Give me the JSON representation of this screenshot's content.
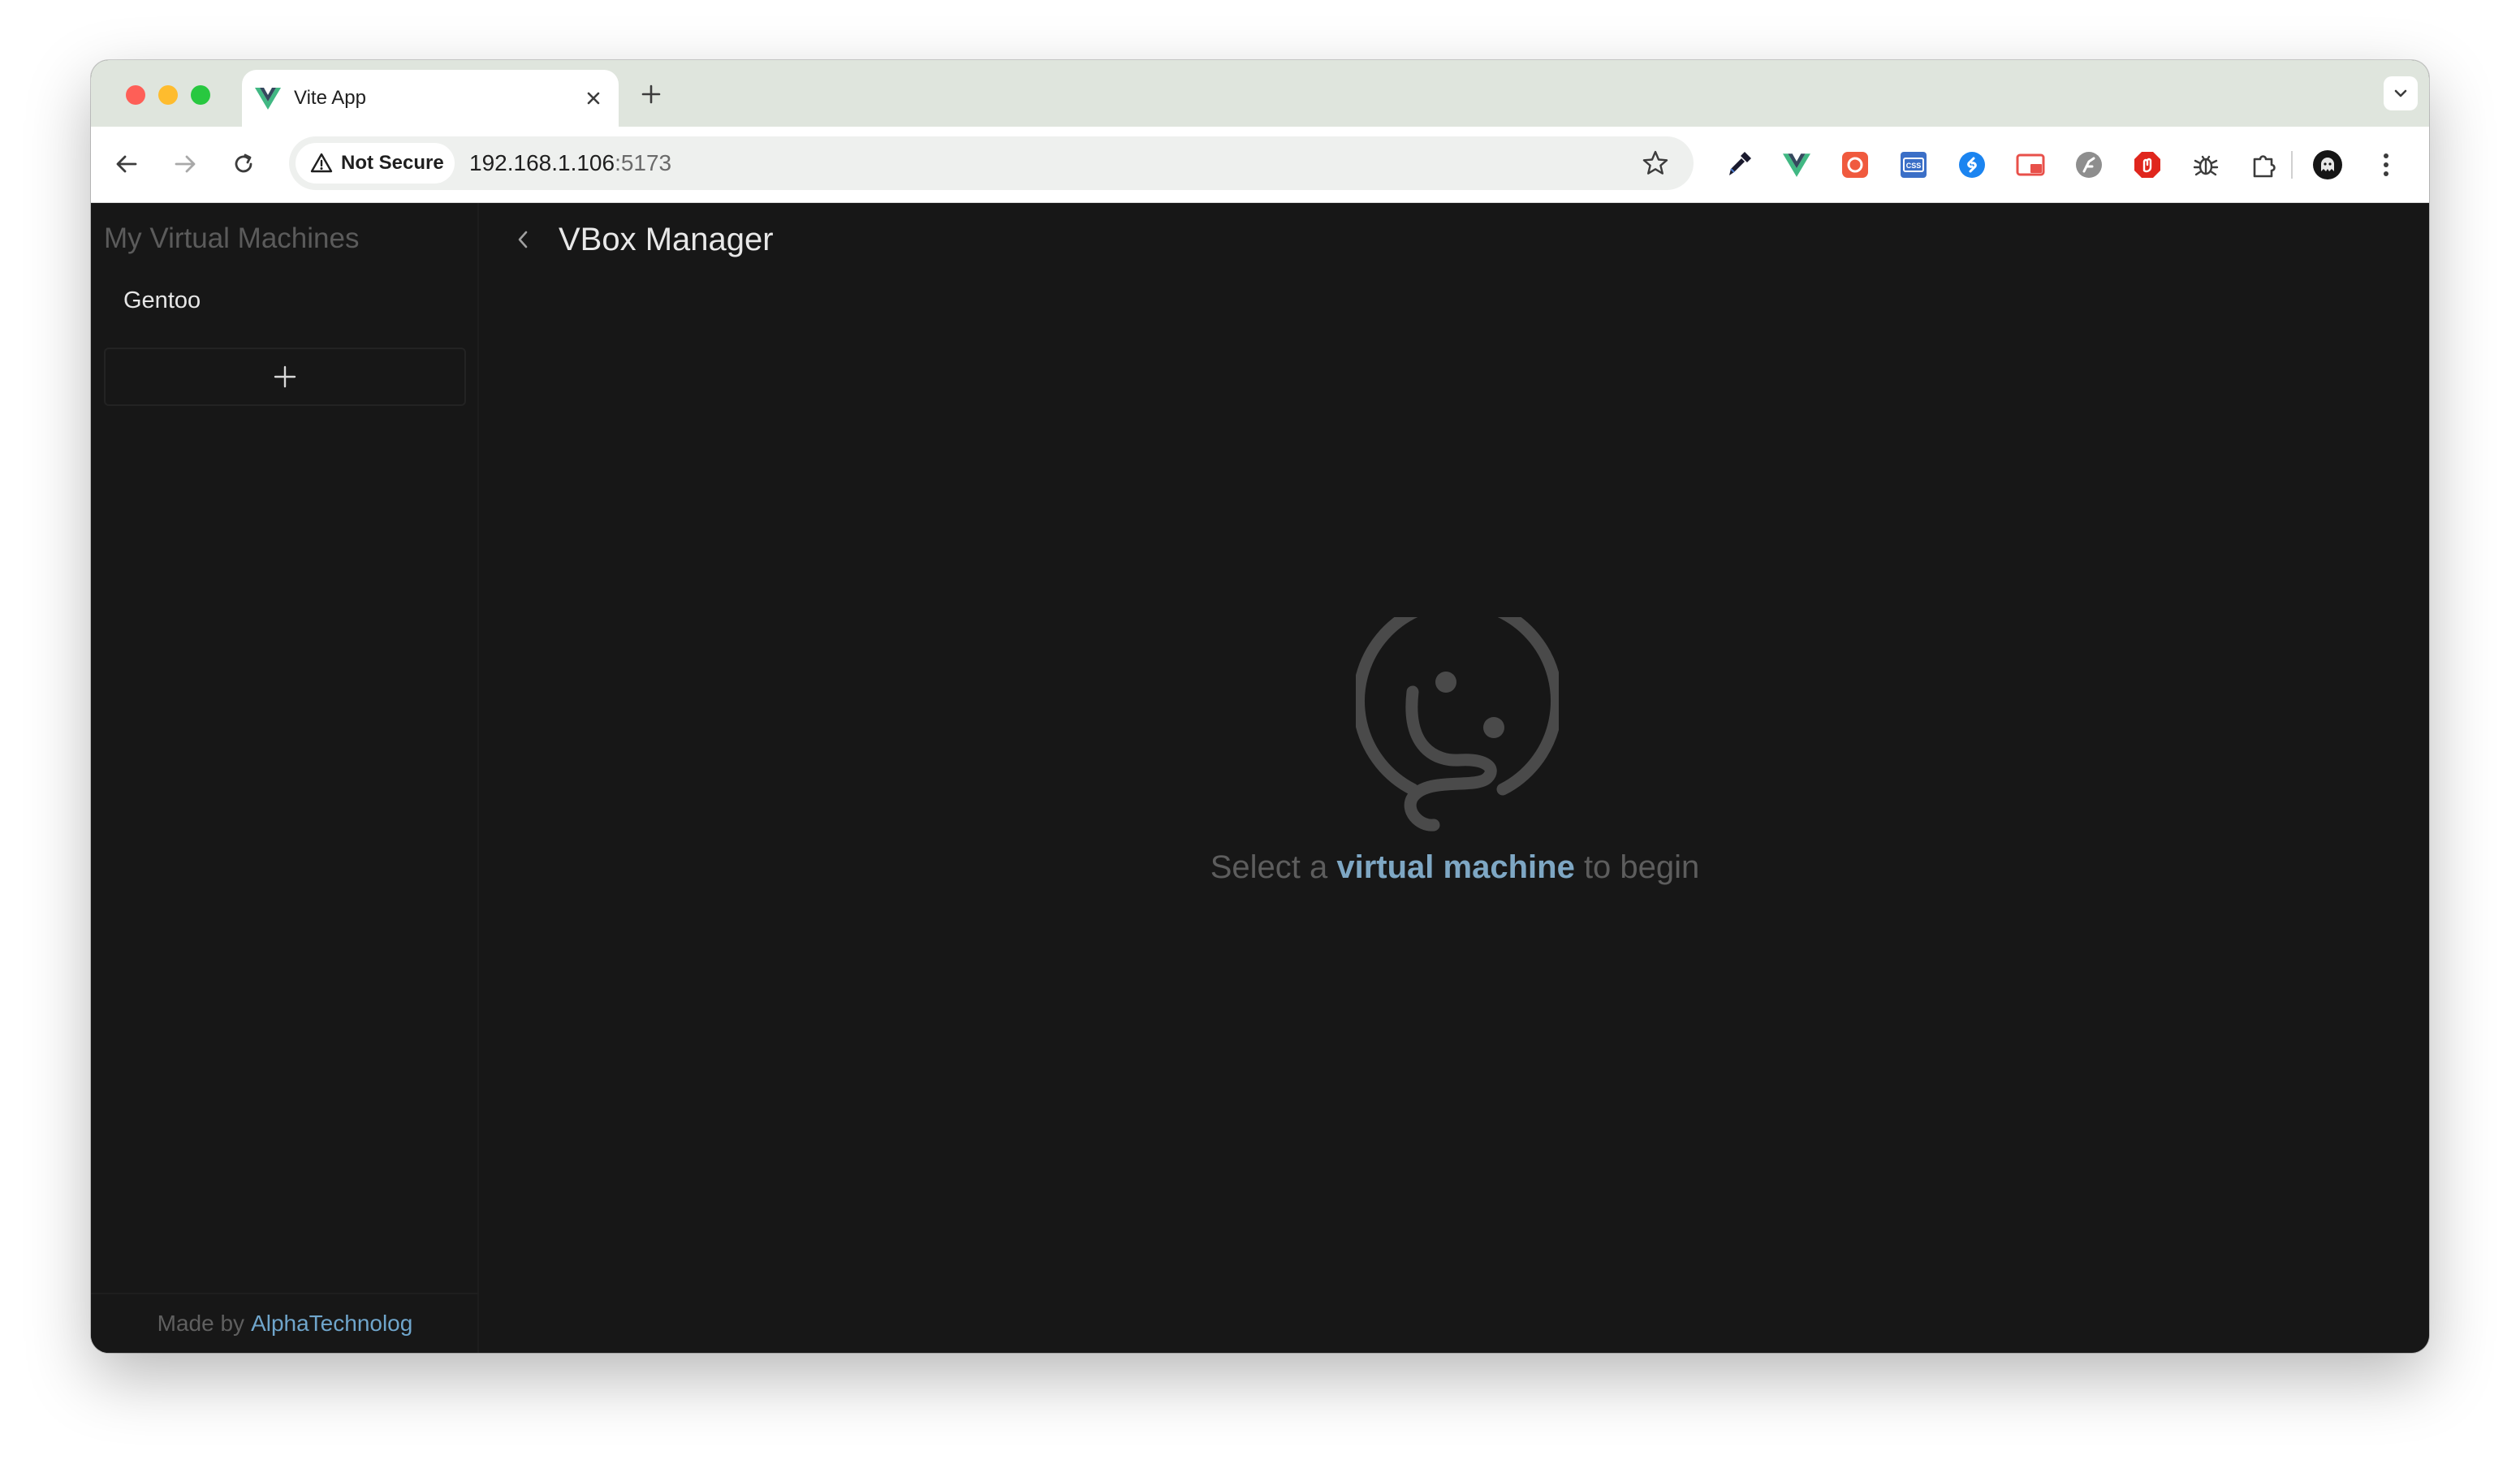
{
  "browser": {
    "tab": {
      "title": "Vite App"
    },
    "omnibox": {
      "security_label": "Not Secure",
      "url_host": "192.168.1.106",
      "url_port": ":5173"
    },
    "extensions": [
      "eyedropper-icon",
      "vue-devtools-icon",
      "record-icon",
      "css-icon",
      "shazam-icon",
      "picture-in-picture-icon",
      "fx-icon",
      "adblock-icon",
      "bug-icon",
      "extensions-puzzle-icon"
    ],
    "profile_icon": "profile-avatar-icon"
  },
  "sidebar": {
    "title": "My Virtual Machines",
    "items": [
      {
        "label": "Gentoo"
      }
    ],
    "add_icon": "plus-icon",
    "footer": {
      "prefix": "Made by",
      "link": "AlphaTechnolog"
    }
  },
  "header": {
    "title": "VBox Manager"
  },
  "empty_state": {
    "icon": "sleepy-face-icon",
    "text_before": "Select a",
    "text_highlight": "virtual machine",
    "text_after": "to begin"
  },
  "colors": {
    "app_background": "#171717",
    "accent": "#7ea7c4",
    "muted_text": "#5d5d5d",
    "tabstrip": "#dfe5dd"
  }
}
